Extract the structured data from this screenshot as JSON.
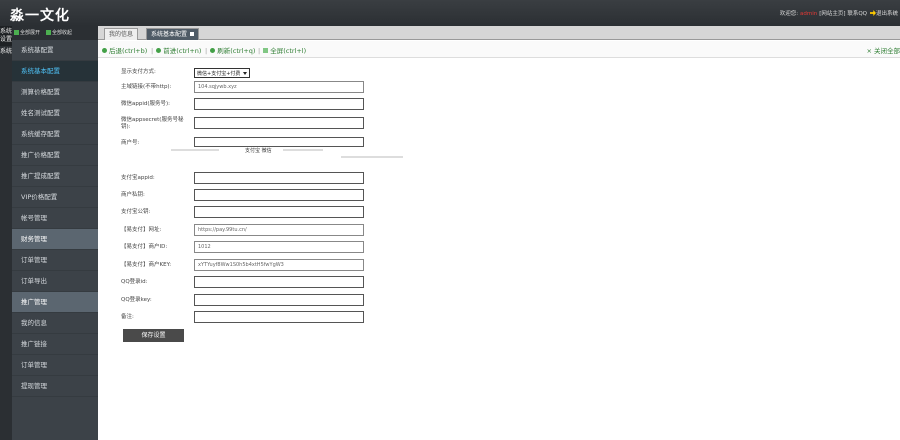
{
  "header": {
    "logo": "淼一文化",
    "welcome": "欢迎您:",
    "username": "admin",
    "links": "[网站主页] 联系QQ",
    "logout": "退出系统"
  },
  "rail": [
    "系统设置",
    "系统"
  ],
  "sidebar": {
    "expand_all": "全部展开",
    "collapse_all": "全部收起",
    "items": [
      {
        "label": "系统基配置",
        "state": "normal"
      },
      {
        "label": "系统基本配置",
        "state": "active"
      },
      {
        "label": "测算价格配置",
        "state": "normal"
      },
      {
        "label": "姓名测试配置",
        "state": "normal"
      },
      {
        "label": "系统缓存配置",
        "state": "normal"
      },
      {
        "label": "推广价格配置",
        "state": "normal"
      },
      {
        "label": "推广提成配置",
        "state": "normal"
      },
      {
        "label": "VIP价格配置",
        "state": "normal"
      },
      {
        "label": "帐号管理",
        "state": "normal"
      },
      {
        "label": "财务管理",
        "state": "group"
      },
      {
        "label": "订单管理",
        "state": "normal"
      },
      {
        "label": "订单导出",
        "state": "normal"
      },
      {
        "label": "推广管理",
        "state": "group"
      },
      {
        "label": "我的信息",
        "state": "normal"
      },
      {
        "label": "推广链接",
        "state": "normal"
      },
      {
        "label": "订单管理",
        "state": "normal"
      },
      {
        "label": "提现管理",
        "state": "normal"
      }
    ]
  },
  "tabs": [
    {
      "label": "我的信息"
    },
    {
      "label": "系统基本配置"
    }
  ],
  "toolbar": {
    "back": "后退(ctrl+b)",
    "forward": "前进(ctrl+n)",
    "refresh": "刷新(ctrl+q)",
    "fullscreen": "全屏(ctrl+l)",
    "close_all": "关闭全部"
  },
  "form": {
    "display_mode_label": "显示支付方式:",
    "display_mode_value": "微信+支付宝+付费",
    "domain_label": "主域链接(不带http):",
    "domain_value": "104.sqjywb.xyz",
    "appid_label": "微信appid(服务号):",
    "appid_value": "",
    "appsecret_label": "微信appsecret(服务号秘钥):",
    "appsecret_value": "",
    "merchant_label": "商户号:",
    "merchant_value": "",
    "pay_note": "支付宝  微信",
    "alipay_id_label": "支付宝appid:",
    "alipay_id_value": "",
    "pid_label": "商户私钥:",
    "pid_value": "",
    "alipay_key_label": "支付宝公钥:",
    "alipay_key_value": "",
    "api_url_label": "【易支付】网址:",
    "api_url_value": "https://pay.99tu.cn/",
    "api_id_label": "【易支付】商户ID:",
    "api_id_value": "1012",
    "api_key_label": "【易支付】商户KEY:",
    "api_key_value": "xYTYuyf8Ww1S0h5b4xtH5fwYgW3",
    "qq_label": "QQ登录id:",
    "qq_value": "",
    "qqkey_label": "QQ登录key:",
    "qqkey_value": "",
    "remark_label": "备注:",
    "remark_value": "",
    "save": "保存设置"
  },
  "colors": {
    "header_bg": "#2b2f33",
    "sidebar_bg": "#3c4248",
    "active_menu": "#4fc3f7",
    "tool_green": "#2e7d32"
  }
}
